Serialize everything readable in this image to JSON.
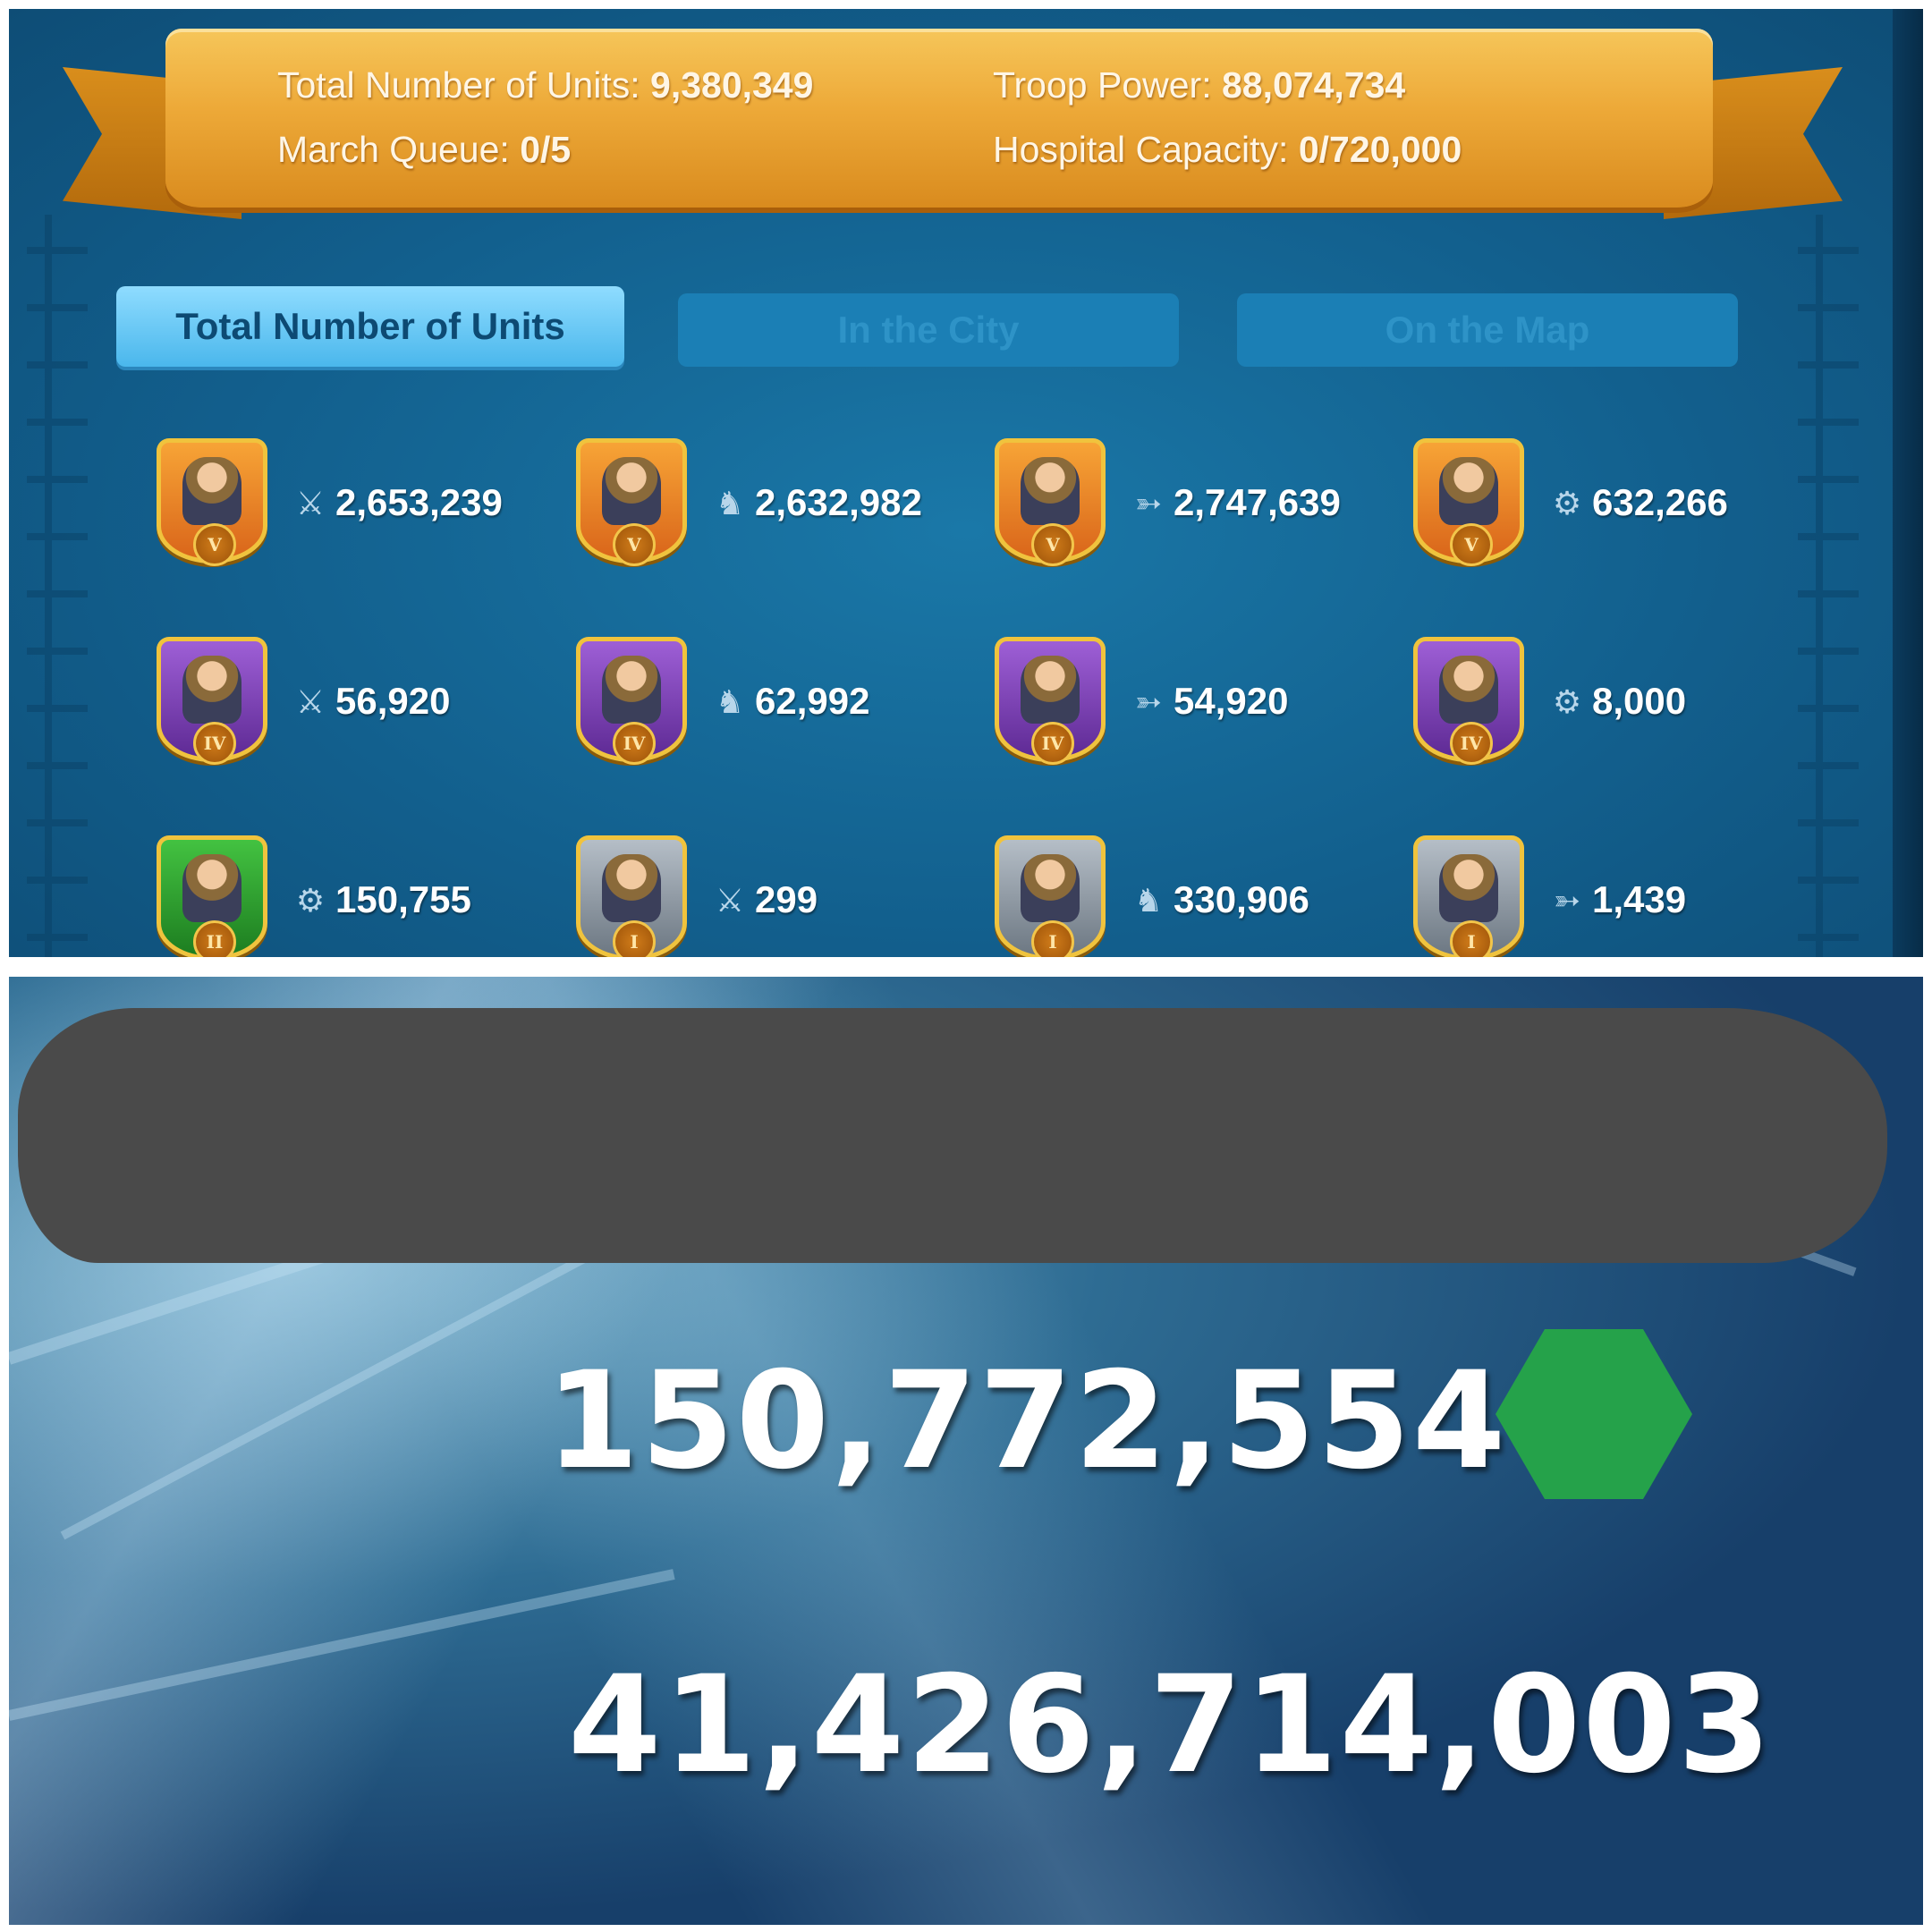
{
  "header": {
    "total_units_label": "Total Number of Units:",
    "total_units_value": "9,380,349",
    "troop_power_label": "Troop Power:",
    "troop_power_value": "88,074,734",
    "march_queue_label": "March Queue:",
    "march_queue_value": "0/5",
    "hospital_label": "Hospital Capacity:",
    "hospital_value": "0/720,000"
  },
  "tabs": [
    {
      "label": "Total Number of Units",
      "active": true
    },
    {
      "label": "In the City",
      "active": false
    },
    {
      "label": "On the Map",
      "active": false
    }
  ],
  "units": [
    {
      "tier": "V",
      "type": "infantry",
      "type_icon": "sword-icon",
      "count": "2,653,239",
      "badge_color": "orange"
    },
    {
      "tier": "V",
      "type": "cavalry",
      "type_icon": "horse-icon",
      "count": "2,632,982",
      "badge_color": "orange"
    },
    {
      "tier": "V",
      "type": "archer",
      "type_icon": "bow-icon",
      "count": "2,747,639",
      "badge_color": "orange"
    },
    {
      "tier": "V",
      "type": "siege",
      "type_icon": "siege-icon",
      "count": "632,266",
      "badge_color": "orange"
    },
    {
      "tier": "IV",
      "type": "infantry",
      "type_icon": "sword-icon",
      "count": "56,920",
      "badge_color": "purple"
    },
    {
      "tier": "IV",
      "type": "cavalry",
      "type_icon": "horse-icon",
      "count": "62,992",
      "badge_color": "purple"
    },
    {
      "tier": "IV",
      "type": "archer",
      "type_icon": "bow-icon",
      "count": "54,920",
      "badge_color": "purple"
    },
    {
      "tier": "IV",
      "type": "siege",
      "type_icon": "siege-icon",
      "count": "8,000",
      "badge_color": "purple"
    },
    {
      "tier": "II",
      "type": "siege",
      "type_icon": "siege-icon",
      "count": "150,755",
      "badge_color": "green"
    },
    {
      "tier": "I",
      "type": "infantry",
      "type_icon": "sword-icon",
      "count": "299",
      "badge_color": "grey"
    },
    {
      "tier": "I",
      "type": "cavalry",
      "type_icon": "horse-icon",
      "count": "330,906",
      "badge_color": "grey"
    },
    {
      "tier": "I",
      "type": "archer",
      "type_icon": "bow-icon",
      "count": "1,439",
      "badge_color": "grey"
    }
  ],
  "profile": {
    "power": "150,772,554",
    "power_icon": "green-gem-icon",
    "kill_points": "41,426,714,003"
  },
  "colors": {
    "banner_gold": "#eda938",
    "panel_blue": "#125f8d",
    "tab_active": "#4ab7ec",
    "gem_green": "#25a24a"
  }
}
